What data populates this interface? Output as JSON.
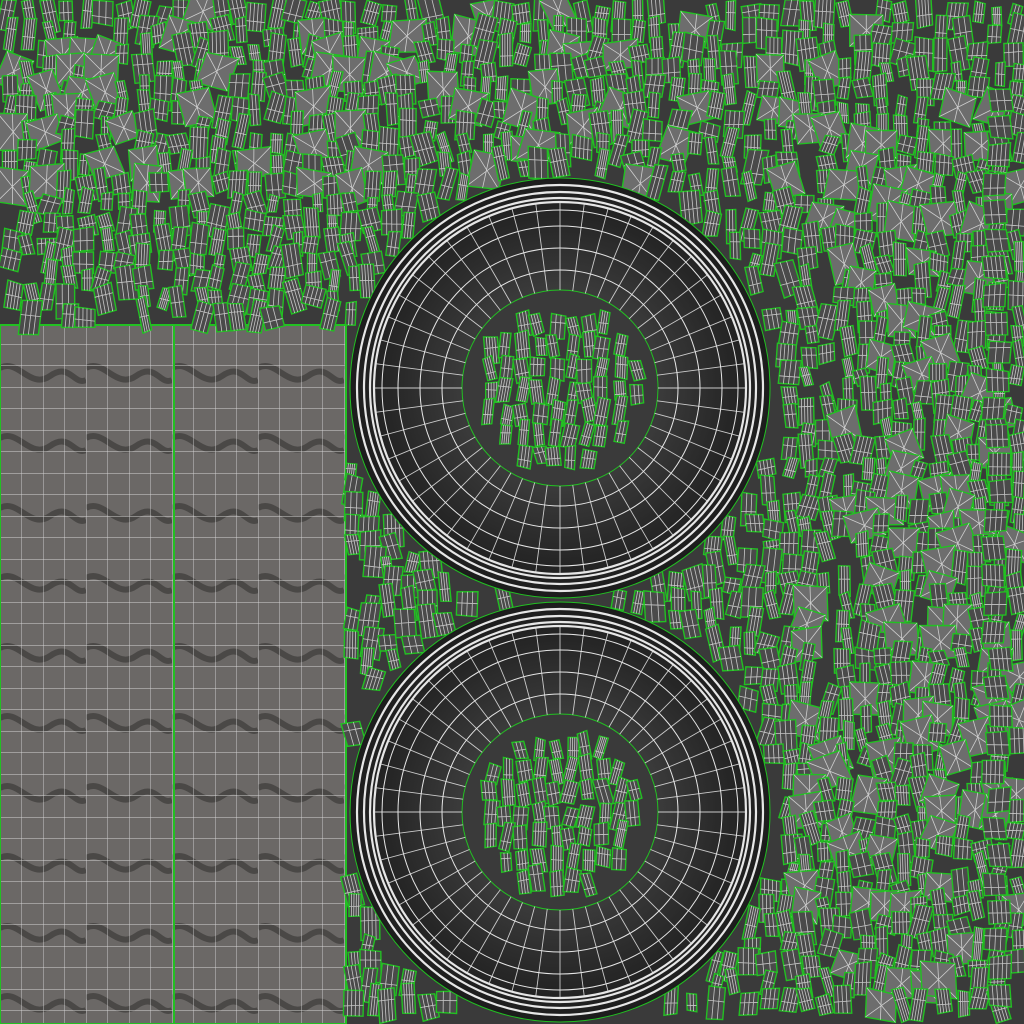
{
  "view": {
    "kind": "uv-layout-texture",
    "background_color": "#3a3a3a",
    "island_outline_color": "#22c022",
    "wire_color": "#e6e6e6",
    "tread_panel_color": "#6b6866"
  },
  "regions": {
    "tread_panels": 2,
    "tire_rings": 2,
    "small_islands": "many"
  }
}
